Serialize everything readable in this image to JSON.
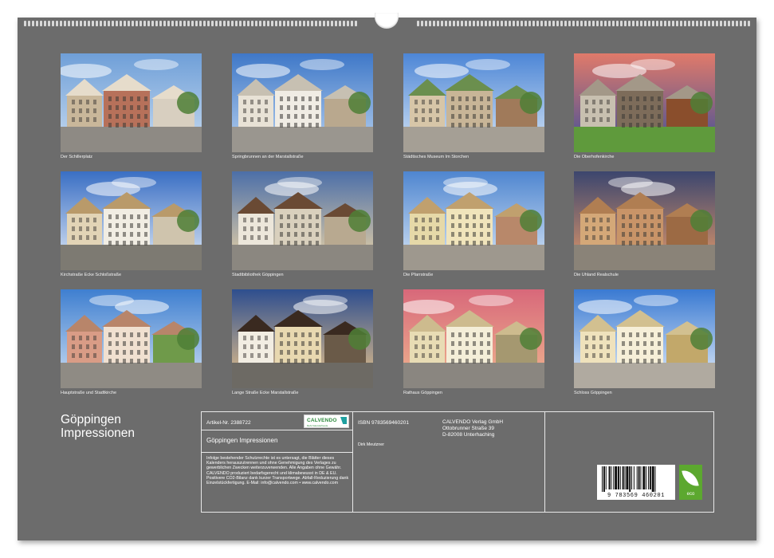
{
  "photos": [
    {
      "caption": "Der Schillerplatz"
    },
    {
      "caption": "Springbrunnen an der Marstallstraße"
    },
    {
      "caption": "Städtisches Museum Im Storchen"
    },
    {
      "caption": "Die Oberhofenkirche"
    },
    {
      "caption": "Kirchstraße Ecke Schloßstraße"
    },
    {
      "caption": "Stadtbibliothek Göppingen"
    },
    {
      "caption": "Die Pfarrstraße"
    },
    {
      "caption": "Die Uhland Realschule"
    },
    {
      "caption": "Hauptstraße und Stadtkirche"
    },
    {
      "caption": "Lange Straße Ecke Marstallstraße"
    },
    {
      "caption": "Rathaus Göppingen"
    },
    {
      "caption": "Schloss Göppingen"
    }
  ],
  "title": {
    "line1": "Göppingen",
    "line2": "Impressionen"
  },
  "info": {
    "artikel": "Artikel-Nr. 2388722",
    "logo_text": "CALVENDO",
    "logo_sub": "Mehr Kalenderfreude",
    "subtitle": "Göppingen Impressionen",
    "legal": "Infolge bestehender Schutzrechte ist es untersagt, die Blätter dieses Kalenders herauszutrennen und ohne Genehmigung des Verlages zu gewerblichen Zwecken weiterzuverwenden. Alle Angaben ohne Gewähr. CALVENDO produziert bedarfsgerecht und klimabewusst in DE & EU. Positivere CO2-Bilanz dank kurzer Transportwege. Abfall-Reduzierung dank Einzelstückfertigung. E-Mail: info@calvendo.com • www.calvendo.com",
    "isbn": "ISBN 9783569460201",
    "author": "Dirk Meutzner",
    "publisher_name": "CALVENDO Verlag GmbH",
    "publisher_street": "Ottobrunner Straße 39",
    "publisher_city": "D-82008 Unterhaching",
    "barcode_number": "9 783569 460201",
    "eco_label": "eco"
  }
}
